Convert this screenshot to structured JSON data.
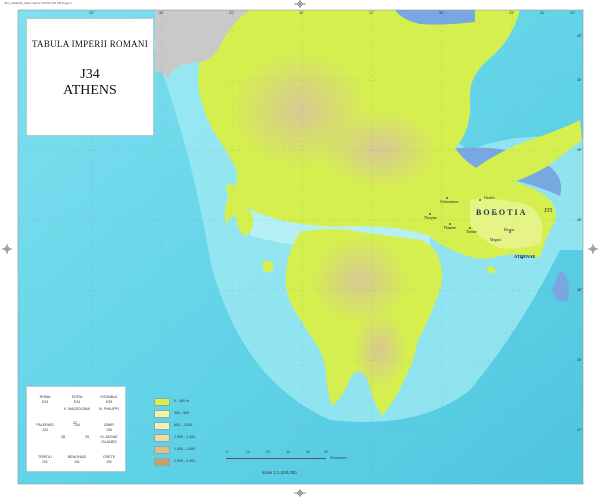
{
  "title": {
    "series": "TABULA IMPERII ROMANI",
    "sheet_number": "J34",
    "sheet_name": "ATHENS"
  },
  "print_note": "J34_ATHENS_bathy.indd 1   6/1/09   4:45 PM   Page 1",
  "adjacent_sheet": "J35",
  "region_label": "BOEOTIA",
  "places": [
    {
      "name": "ATHENAE",
      "emphasis": true
    },
    {
      "name": "Thebae",
      "emphasis": false
    },
    {
      "name": "Chalcis",
      "emphasis": false
    },
    {
      "name": "Orchomenus",
      "emphasis": false
    },
    {
      "name": "Plataeae",
      "emphasis": false
    },
    {
      "name": "Thespiae",
      "emphasis": false
    },
    {
      "name": "Megara",
      "emphasis": false
    },
    {
      "name": "Eleusis",
      "emphasis": false
    }
  ],
  "sheet_index": {
    "cells": [
      {
        "line1": "ROMA",
        "line2": "K33"
      },
      {
        "line1": "SOFIA",
        "line2": "K34"
      },
      {
        "line1": "ISTANBUL",
        "line2": "K35"
      },
      {
        "line1": "",
        "line2": "II. MACEDONIA"
      },
      {
        "line1": "",
        "line2": "III. PHILIPPI"
      },
      {
        "line1": "PALERMO",
        "line2": "J33"
      },
      {
        "line1": "",
        "line2": "J34"
      },
      {
        "line1": "IZMIR",
        "line2": "J35"
      },
      {
        "line1": "",
        "line2": "IV. AEGAE ISLANDS"
      },
      {
        "line1": "TRIPOLI",
        "line2": "I33"
      },
      {
        "line1": "BENGHAZI",
        "line2": "I34"
      },
      {
        "line1": "CRETE",
        "line2": "I35"
      }
    ],
    "middle_labels": [
      "27",
      "28",
      "29"
    ]
  },
  "legend": {
    "items": [
      {
        "label": "0 - 300 m",
        "color": "#d5f04e"
      },
      {
        "label": "300 - 600",
        "color": "#eef5a6"
      },
      {
        "label": "600 - 1,000",
        "color": "#f2efbe"
      },
      {
        "label": "1,000 - 1,300",
        "color": "#e8dcaa"
      },
      {
        "label": "1,300 - 1,600",
        "color": "#d9c28a"
      },
      {
        "label": "2,000 - 2,900",
        "color": "#c9a163"
      }
    ]
  },
  "scale": {
    "ticks": [
      "0",
      "10",
      "20",
      "30",
      "40",
      "50"
    ],
    "unit": "Kilometres",
    "text": "scale 1:1,000,000"
  },
  "graticule": {
    "top": [
      "20°",
      "30'",
      "21°",
      "30'",
      "22°",
      "30'",
      "23°",
      "30'",
      "24°"
    ],
    "left": [
      "40°",
      "30'",
      "39°",
      "30'",
      "38°",
      "30'",
      "37°"
    ]
  },
  "colors": {
    "sea_deep": "#5ad0e6",
    "sea_shallow": "#a2ebf3",
    "lake": "#79a7e2",
    "land": "#d5f04e",
    "neighbor": "#c9c9c9",
    "frame": "#ffffff"
  },
  "icons": {
    "registration": "crosshair-icon",
    "site": "settlement-dot-icon"
  }
}
